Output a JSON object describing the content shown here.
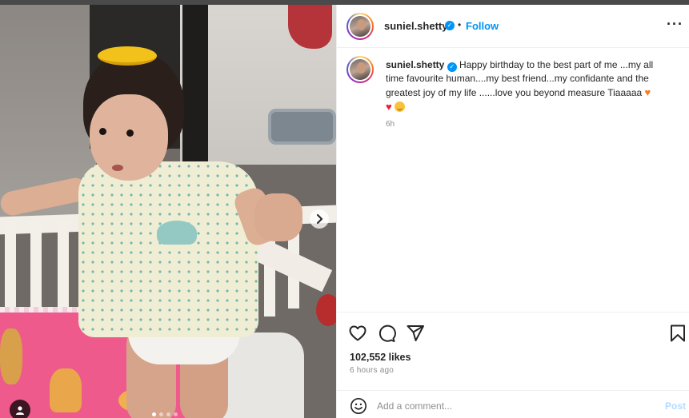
{
  "post": {
    "username": "suniel.shetty",
    "verified_icon": "verified-badge-icon",
    "separator": "•",
    "follow_label": "Follow",
    "more_icon": "more-options-icon",
    "more_glyph": "···"
  },
  "caption": {
    "username": "suniel.shetty",
    "text": "Happy birthday to the best part of me ...my all time favourite human....my best friend...my confidante and the greatest joy of my life ......love you beyond measure Tiaaaaa",
    "emoji_orange_heart": "♥",
    "emoji_red_heart": "♥",
    "time": "6h"
  },
  "engagement": {
    "likes": "102,552 likes",
    "posted": "6 hours ago"
  },
  "comment": {
    "placeholder": "Add a comment...",
    "post_label": "Post"
  },
  "carousel": {
    "slide_count": 4,
    "active_index": 0
  },
  "colors": {
    "accent": "#0095f6",
    "post_disabled": "#b3dbff",
    "text": "#262626",
    "muted": "#8e8e8e"
  }
}
